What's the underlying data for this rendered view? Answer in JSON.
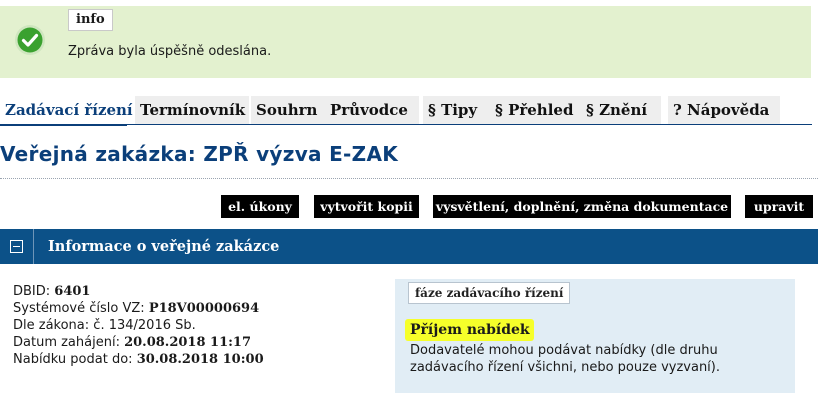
{
  "banner": {
    "label": "info",
    "message": "Zpráva byla úspěšně odeslána.",
    "icon": "checkmark-icon",
    "icon_color": "#3aa12f"
  },
  "tabs": [
    {
      "label": "Zadávací řízení",
      "active": true
    },
    {
      "label": "Termínovník"
    },
    {
      "label": "Souhrn"
    },
    {
      "label": "Průvodce"
    },
    {
      "label": "§ Tipy"
    },
    {
      "label": "§ Přehled"
    },
    {
      "label": "§ Znění"
    },
    {
      "label": "? Nápověda"
    }
  ],
  "page_title": "Veřejná zakázka: ZPŘ výzva E-ZAK",
  "actions": [
    "el. úkony",
    "vytvořit kopii",
    "vysvětlení, doplnění, změna dokumentace",
    "upravit"
  ],
  "section": {
    "title": "Informace o veřejné zakázce"
  },
  "info": {
    "dbid_label": "DBID:",
    "dbid": "6401",
    "sysnum_label": "Systémové číslo VZ:",
    "sysnum": "P18V00000694",
    "law_label": "Dle zákona:",
    "law": "č. 134/2016 Sb.",
    "start_label": "Datum zahájení:",
    "start": "20.08.2018 11:17",
    "deadline_label": "Nabídku podat do:",
    "deadline": "30.08.2018 10:00"
  },
  "phase": {
    "tag": "fáze zadávacího řízení",
    "name": "Příjem nabídek",
    "description": "Dodavatelé mohou podávat nabídky (dle druhu zadávacího řízení všichni, nebo pouze vyzvaní)."
  },
  "colors": {
    "accent": "#0c5188",
    "banner_bg": "#e3f1cf",
    "highlight": "#f6ff2a"
  }
}
